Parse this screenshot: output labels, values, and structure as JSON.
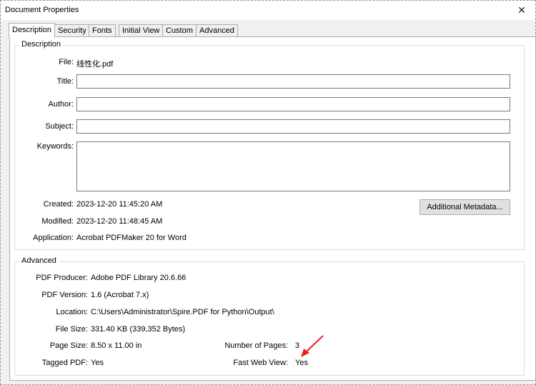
{
  "window": {
    "title": "Document Properties",
    "close_glyph": "✕"
  },
  "tabs": [
    "Description",
    "Security",
    "Fonts",
    "Initial View",
    "Custom",
    "Advanced"
  ],
  "description": {
    "legend": "Description",
    "file_label": "File:",
    "file_value": "线性化.pdf",
    "title_label": "Title:",
    "title_value": "",
    "author_label": "Author:",
    "author_value": "",
    "subject_label": "Subject:",
    "subject_value": "",
    "keywords_label": "Keywords:",
    "keywords_value": "",
    "created_label": "Created:",
    "created_value": "2023-12-20 11:45:20 AM",
    "modified_label": "Modified:",
    "modified_value": "2023-12-20 11:48:45 AM",
    "application_label": "Application:",
    "application_value": "Acrobat PDFMaker 20 for Word",
    "metadata_button": "Additional Metadata..."
  },
  "advanced": {
    "legend": "Advanced",
    "producer_label": "PDF Producer:",
    "producer_value": "Adobe PDF Library 20.6.66",
    "version_label": "PDF Version:",
    "version_value": "1.6 (Acrobat 7.x)",
    "location_label": "Location:",
    "location_value": "C:\\Users\\Administrator\\Spire.PDF for Python\\Output\\",
    "filesize_label": "File Size:",
    "filesize_value": "331.40 KB (339,352 Bytes)",
    "pagesize_label": "Page Size:",
    "pagesize_value": "8.50 x 11.00 in",
    "numpages_label": "Number of Pages:",
    "numpages_value": "3",
    "tagged_label": "Tagged PDF:",
    "tagged_value": "Yes",
    "fastweb_label": "Fast Web View:",
    "fastweb_value": "Yes"
  },
  "annotation": {
    "arrow_color": "#e8211c"
  }
}
